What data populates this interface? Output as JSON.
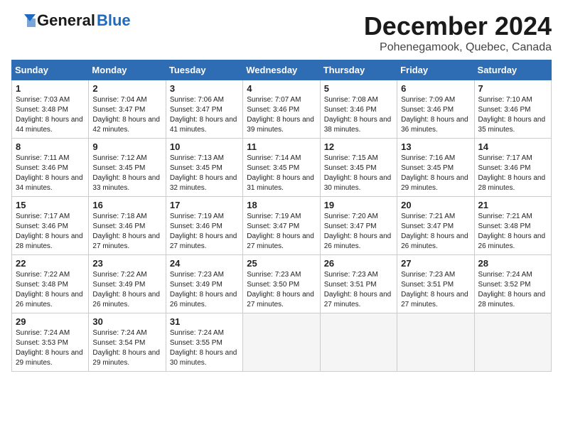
{
  "logo": {
    "general": "General",
    "blue": "Blue"
  },
  "title": "December 2024",
  "location": "Pohenegamook, Quebec, Canada",
  "headers": [
    "Sunday",
    "Monday",
    "Tuesday",
    "Wednesday",
    "Thursday",
    "Friday",
    "Saturday"
  ],
  "weeks": [
    [
      {
        "day": "1",
        "sunrise": "7:03 AM",
        "sunset": "3:48 PM",
        "daylight": "8 hours and 44 minutes."
      },
      {
        "day": "2",
        "sunrise": "7:04 AM",
        "sunset": "3:47 PM",
        "daylight": "8 hours and 42 minutes."
      },
      {
        "day": "3",
        "sunrise": "7:06 AM",
        "sunset": "3:47 PM",
        "daylight": "8 hours and 41 minutes."
      },
      {
        "day": "4",
        "sunrise": "7:07 AM",
        "sunset": "3:46 PM",
        "daylight": "8 hours and 39 minutes."
      },
      {
        "day": "5",
        "sunrise": "7:08 AM",
        "sunset": "3:46 PM",
        "daylight": "8 hours and 38 minutes."
      },
      {
        "day": "6",
        "sunrise": "7:09 AM",
        "sunset": "3:46 PM",
        "daylight": "8 hours and 36 minutes."
      },
      {
        "day": "7",
        "sunrise": "7:10 AM",
        "sunset": "3:46 PM",
        "daylight": "8 hours and 35 minutes."
      }
    ],
    [
      {
        "day": "8",
        "sunrise": "7:11 AM",
        "sunset": "3:46 PM",
        "daylight": "8 hours and 34 minutes."
      },
      {
        "day": "9",
        "sunrise": "7:12 AM",
        "sunset": "3:45 PM",
        "daylight": "8 hours and 33 minutes."
      },
      {
        "day": "10",
        "sunrise": "7:13 AM",
        "sunset": "3:45 PM",
        "daylight": "8 hours and 32 minutes."
      },
      {
        "day": "11",
        "sunrise": "7:14 AM",
        "sunset": "3:45 PM",
        "daylight": "8 hours and 31 minutes."
      },
      {
        "day": "12",
        "sunrise": "7:15 AM",
        "sunset": "3:45 PM",
        "daylight": "8 hours and 30 minutes."
      },
      {
        "day": "13",
        "sunrise": "7:16 AM",
        "sunset": "3:45 PM",
        "daylight": "8 hours and 29 minutes."
      },
      {
        "day": "14",
        "sunrise": "7:17 AM",
        "sunset": "3:46 PM",
        "daylight": "8 hours and 28 minutes."
      }
    ],
    [
      {
        "day": "15",
        "sunrise": "7:17 AM",
        "sunset": "3:46 PM",
        "daylight": "8 hours and 28 minutes."
      },
      {
        "day": "16",
        "sunrise": "7:18 AM",
        "sunset": "3:46 PM",
        "daylight": "8 hours and 27 minutes."
      },
      {
        "day": "17",
        "sunrise": "7:19 AM",
        "sunset": "3:46 PM",
        "daylight": "8 hours and 27 minutes."
      },
      {
        "day": "18",
        "sunrise": "7:19 AM",
        "sunset": "3:47 PM",
        "daylight": "8 hours and 27 minutes."
      },
      {
        "day": "19",
        "sunrise": "7:20 AM",
        "sunset": "3:47 PM",
        "daylight": "8 hours and 26 minutes."
      },
      {
        "day": "20",
        "sunrise": "7:21 AM",
        "sunset": "3:47 PM",
        "daylight": "8 hours and 26 minutes."
      },
      {
        "day": "21",
        "sunrise": "7:21 AM",
        "sunset": "3:48 PM",
        "daylight": "8 hours and 26 minutes."
      }
    ],
    [
      {
        "day": "22",
        "sunrise": "7:22 AM",
        "sunset": "3:48 PM",
        "daylight": "8 hours and 26 minutes."
      },
      {
        "day": "23",
        "sunrise": "7:22 AM",
        "sunset": "3:49 PM",
        "daylight": "8 hours and 26 minutes."
      },
      {
        "day": "24",
        "sunrise": "7:23 AM",
        "sunset": "3:49 PM",
        "daylight": "8 hours and 26 minutes."
      },
      {
        "day": "25",
        "sunrise": "7:23 AM",
        "sunset": "3:50 PM",
        "daylight": "8 hours and 27 minutes."
      },
      {
        "day": "26",
        "sunrise": "7:23 AM",
        "sunset": "3:51 PM",
        "daylight": "8 hours and 27 minutes."
      },
      {
        "day": "27",
        "sunrise": "7:23 AM",
        "sunset": "3:51 PM",
        "daylight": "8 hours and 27 minutes."
      },
      {
        "day": "28",
        "sunrise": "7:24 AM",
        "sunset": "3:52 PM",
        "daylight": "8 hours and 28 minutes."
      }
    ],
    [
      {
        "day": "29",
        "sunrise": "7:24 AM",
        "sunset": "3:53 PM",
        "daylight": "8 hours and 29 minutes."
      },
      {
        "day": "30",
        "sunrise": "7:24 AM",
        "sunset": "3:54 PM",
        "daylight": "8 hours and 29 minutes."
      },
      {
        "day": "31",
        "sunrise": "7:24 AM",
        "sunset": "3:55 PM",
        "daylight": "8 hours and 30 minutes."
      },
      null,
      null,
      null,
      null
    ]
  ]
}
